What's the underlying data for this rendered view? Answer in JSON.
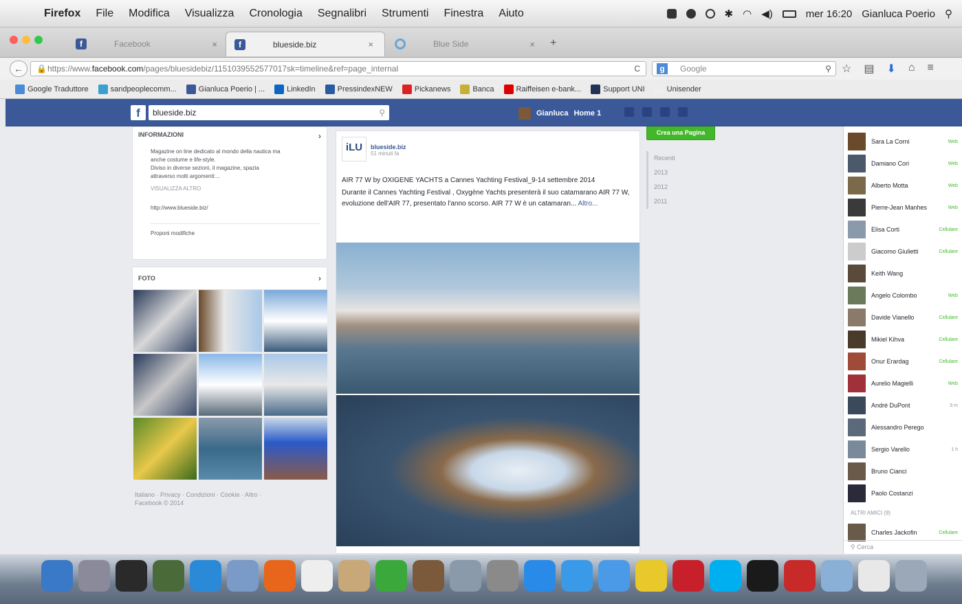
{
  "menubar": {
    "apple": "",
    "items": [
      "Firefox",
      "File",
      "Modifica",
      "Visualizza",
      "Cronologia",
      "Segnalibri",
      "Strumenti",
      "Finestra",
      "Aiuto"
    ],
    "clock": "mer 16:20",
    "user": "Gianluca Poerio"
  },
  "tabs": [
    {
      "label": "Facebook",
      "icon": "facebook-icon",
      "color": "#3b5998"
    },
    {
      "label": "blueside.biz",
      "icon": "facebook-icon",
      "color": "#3b5998"
    },
    {
      "label": "Blue Side",
      "icon": "loading-icon",
      "color": "#6aa6d8"
    }
  ],
  "address": {
    "prefix": "https://www.",
    "domain": "facebook.com",
    "path": "/pages/bluesidebiz/1151039552577017sk=timeline&ref=page_internal"
  },
  "search": {
    "placeholder": "Google"
  },
  "bookmarks": [
    {
      "label": "Google Traduttore",
      "color": "#4a8ad6"
    },
    {
      "label": "sandpeoplecomm...",
      "color": "#3aa0d0"
    },
    {
      "label": "Gianluca Poerio | ...",
      "color": "#3b5998"
    },
    {
      "label": "LinkedIn",
      "color": "#0a66c2"
    },
    {
      "label": "PressindexNEW",
      "color": "#2a5aa0"
    },
    {
      "label": "Pickanews",
      "color": "#d22"
    },
    {
      "label": "Banca",
      "color": "#c8b038"
    },
    {
      "label": "Raiffeisen e-bank...",
      "color": "#d00"
    },
    {
      "label": "Support UNI",
      "color": "#235"
    },
    {
      "label": "Unisender",
      "color": "#eee"
    }
  ],
  "facebook": {
    "search_value": "blueside.biz",
    "user": "Gianluca",
    "home": "Home 1"
  },
  "info": {
    "heading": "INFORMAZIONI",
    "lines": [
      "Magazine on line dedicato al mondo della nautica ma",
      "anche costume e life-style.",
      "Diviso in diverse sezioni, il magazine, spazia",
      "attraverso molti argomenti:..."
    ],
    "more": "VISUALIZZA ALTRO",
    "site": "http://www.blueside.biz/",
    "propose": "Proponi modifiche"
  },
  "photos": {
    "heading": "FOTO",
    "footer": [
      "Italiano · Privacy · Condizioni · Cookie · Altro ·",
      "Facebook © 2014"
    ]
  },
  "post": {
    "page": "blueside.biz",
    "time": "51 minuti fa",
    "title": "AIR 77 W by OXIGENE YACHTS a Cannes Yachting Festival_9-14 settembre 2014",
    "body": "Durante il Cannes Yachting Festival , Oxygène Yachts presenterà il suo catamarano AIR 77 W, evoluzione dell'AIR 77, presentato l'anno scorso. AIR 77 W è un catamaran...",
    "more": "Altro..."
  },
  "create_page": "Crea una Pagina",
  "timeline": [
    "Recenti",
    "2013",
    "2012",
    "2011"
  ],
  "chat": {
    "friends": [
      {
        "name": "Sara La Corni",
        "status": "Web",
        "color": "#6a4a2a"
      },
      {
        "name": "Damiano Cori",
        "status": "Web",
        "color": "#4a5a6a"
      },
      {
        "name": "Alberto Motta",
        "status": "Web",
        "color": "#7a6a4a"
      },
      {
        "name": "Pierre-Jean Manhes",
        "status": "Web",
        "color": "#3a3a3a"
      },
      {
        "name": "Elisa Corti",
        "status": "Cellulare",
        "color": "#8a9aaa"
      },
      {
        "name": "Giacomo Giulietti",
        "status": "Cellulare",
        "color": "#ccc"
      },
      {
        "name": "Keith Wang",
        "status": "",
        "color": "#5a4a3a"
      },
      {
        "name": "Angelo Colombo",
        "status": "Web",
        "color": "#6a7a5a"
      },
      {
        "name": "Davide Vianello",
        "status": "Cellulare",
        "color": "#8a7a6a"
      },
      {
        "name": "Mikiel Kihva",
        "status": "Cellulare",
        "color": "#4a3a2a"
      },
      {
        "name": "Onur Erardag",
        "status": "Cellulare",
        "color": "#a04a3a"
      },
      {
        "name": "Aurelio Magielli",
        "status": "Web",
        "color": "#a0303a"
      },
      {
        "name": "André DuPont",
        "status": "9 m",
        "color": "#3a4a5a"
      },
      {
        "name": "Alessandro Perego",
        "status": "",
        "color": "#5a6a7a"
      },
      {
        "name": "Sergio Varello",
        "status": "1 h",
        "color": "#7a8a9a"
      },
      {
        "name": "Bruno Cianci",
        "status": "",
        "color": "#6a5a4a"
      },
      {
        "name": "Paolo Costanzi",
        "status": "",
        "color": "#2a2a3a"
      }
    ],
    "other_heading": "ALTRI AMICI (9)",
    "other": [
      {
        "name": "Charles Jackofin",
        "status": "Cellulare",
        "color": "#6a5a4a"
      }
    ],
    "search_placeholder": "Cerca"
  },
  "dock": [
    {
      "icon": "finder-icon",
      "color": "#3a78c8"
    },
    {
      "icon": "launchpad-icon",
      "color": "#8a8a9a"
    },
    {
      "icon": "dashboard-icon",
      "color": "#2a2a2a"
    },
    {
      "icon": "mission-control-icon",
      "color": "#4a6a3a"
    },
    {
      "icon": "app-store-icon",
      "color": "#2a8ad8"
    },
    {
      "icon": "preview-icon",
      "color": "#7a9ac8"
    },
    {
      "icon": "firefox-icon",
      "color": "#e8661c"
    },
    {
      "icon": "calendar-icon",
      "color": "#eee"
    },
    {
      "icon": "contacts-icon",
      "color": "#c8a878"
    },
    {
      "icon": "evernote-icon",
      "color": "#3aa83a"
    },
    {
      "icon": "iphoto-icon",
      "color": "#7a5a3a"
    },
    {
      "icon": "image-capture-icon",
      "color": "#8a9aaa"
    },
    {
      "icon": "system-preferences-icon",
      "color": "#8a8a8a"
    },
    {
      "icon": "skype-dup-icon",
      "color": "#2a8ae8"
    },
    {
      "icon": "safari-icon",
      "color": "#3a9ae8"
    },
    {
      "icon": "itunes-icon",
      "color": "#4a9ae8"
    },
    {
      "icon": "duck-icon",
      "color": "#e8c82a"
    },
    {
      "icon": "filezilla-icon",
      "color": "#c8202a"
    },
    {
      "icon": "skype-icon",
      "color": "#00aff0"
    },
    {
      "icon": "blackberry-icon",
      "color": "#1a1a1a"
    },
    {
      "icon": "mail-icon",
      "color": "#c82a2a"
    },
    {
      "icon": "folder-icon",
      "color": "#8ab0d8"
    },
    {
      "icon": "document-icon",
      "color": "#e8e8e8"
    },
    {
      "icon": "trash-icon",
      "color": "#9aa8b8"
    }
  ]
}
